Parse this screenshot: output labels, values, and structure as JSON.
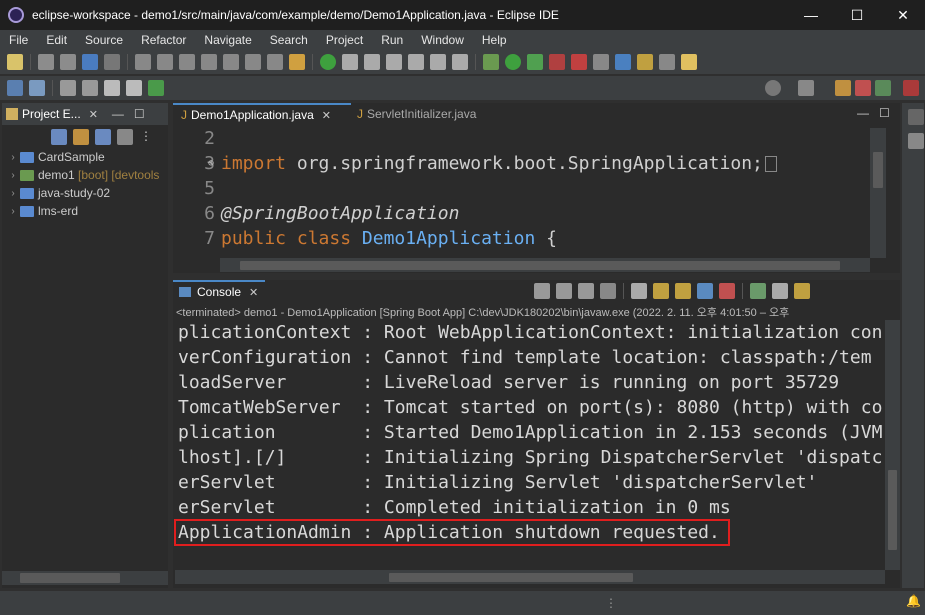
{
  "window": {
    "title": "eclipse-workspace - demo1/src/main/java/com/example/demo/Demo1Application.java - Eclipse IDE"
  },
  "menu": [
    "File",
    "Edit",
    "Source",
    "Refactor",
    "Navigate",
    "Search",
    "Project",
    "Run",
    "Window",
    "Help"
  ],
  "project_explorer": {
    "tab_label": "Project E...",
    "items": [
      {
        "name": "CardSample",
        "suffix": ""
      },
      {
        "name": "demo1",
        "suffix": "[boot] [devtools"
      },
      {
        "name": "java-study-02",
        "suffix": ""
      },
      {
        "name": "lms-erd",
        "suffix": ""
      }
    ]
  },
  "editor": {
    "tabs": [
      "Demo1Application.java",
      "ServletInitializer.java"
    ],
    "lines": [
      {
        "n": "2",
        "text": ""
      },
      {
        "n": "3",
        "text": "import org.springframework.boot.SpringApplication;"
      },
      {
        "n": "5",
        "text": ""
      },
      {
        "n": "6",
        "text": "@SpringBootApplication"
      },
      {
        "n": "7",
        "text": "public class Demo1Application {"
      }
    ]
  },
  "console": {
    "tab_label": "Console",
    "status": "<terminated> demo1 - Demo1Application [Spring Boot App] C:\\dev\\JDK180202\\bin\\javaw.exe  (2022. 2. 11. 오후 4:01:50 – 오후",
    "lines": [
      "plicationContext : Root WebApplicationContext: initialization con",
      "verConfiguration : Cannot find template location: classpath:/tem",
      "loadServer       : LiveReload server is running on port 35729",
      "TomcatWebServer  : Tomcat started on port(s): 8080 (http) with co",
      "plication        : Started Demo1Application in 2.153 seconds (JVM",
      "lhost].[/]       : Initializing Spring DispatcherServlet 'dispatc",
      "erServlet        : Initializing Servlet 'dispatcherServlet'",
      "erServlet        : Completed initialization in 0 ms",
      "ApplicationAdmin : Application shutdown requested."
    ]
  },
  "colors": {
    "highlight": "#e01e1e",
    "keyword": "#cc7832",
    "type": "#6ab0f3"
  }
}
